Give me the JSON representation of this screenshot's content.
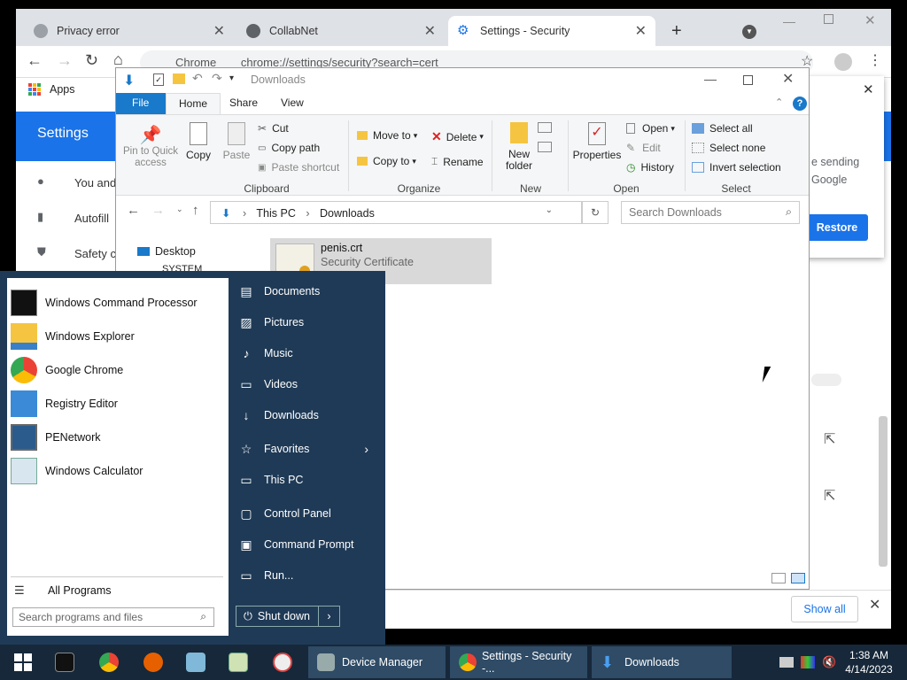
{
  "chrome": {
    "tabs": [
      {
        "title": "Privacy error",
        "icon": "warning-icon"
      },
      {
        "title": "CollabNet",
        "icon": "site-icon"
      },
      {
        "title": "Settings - Security",
        "icon": "gear-icon"
      }
    ],
    "new_tab": "+",
    "address_site": "Chrome",
    "address_url": "chrome://settings/security?search=cert",
    "apps_label": "Apps",
    "settings_title": "Settings",
    "nav": [
      {
        "label": "You and",
        "icon": "person-icon"
      },
      {
        "label": "Autofill",
        "icon": "clipboard-icon"
      },
      {
        "label": "Safety c",
        "icon": "shield-icon"
      }
    ],
    "dialog": {
      "text1": "e sending",
      "text2": "Google",
      "restore": "Restore"
    },
    "shelf": {
      "show_all": "Show all"
    }
  },
  "explorer": {
    "title": "Downloads",
    "tabs": {
      "file": "File",
      "home": "Home",
      "share": "Share",
      "view": "View"
    },
    "ribbon": {
      "pin": "Pin to Quick access",
      "copy": "Copy",
      "paste": "Paste",
      "cut": "Cut",
      "copy_path": "Copy path",
      "paste_shortcut": "Paste shortcut",
      "move_to": "Move to",
      "copy_to": "Copy to",
      "delete": "Delete",
      "rename": "Rename",
      "new_folder": "New folder",
      "properties": "Properties",
      "open": "Open",
      "edit": "Edit",
      "history": "History",
      "select_all": "Select all",
      "select_none": "Select none",
      "invert_selection": "Invert selection",
      "groups": {
        "clipboard": "Clipboard",
        "organize": "Organize",
        "new": "New",
        "open": "Open",
        "select": "Select"
      }
    },
    "breadcrumb": [
      "This PC",
      "Downloads"
    ],
    "search_placeholder": "Search Downloads",
    "nav": {
      "desktop": "Desktop",
      "system": "SYSTEM"
    },
    "file": {
      "name": "penis.crt",
      "type": "Security Certificate"
    }
  },
  "startmenu": {
    "programs": [
      {
        "label": "Windows Command Processor",
        "icon": "cmd-icon"
      },
      {
        "label": "Windows Explorer",
        "icon": "folder-icon"
      },
      {
        "label": "Google Chrome",
        "icon": "chrome-icon"
      },
      {
        "label": "Registry Editor",
        "icon": "registry-icon"
      },
      {
        "label": "PENetwork",
        "icon": "network-icon"
      },
      {
        "label": "Windows Calculator",
        "icon": "calculator-icon"
      }
    ],
    "all_programs": "All Programs",
    "search_placeholder": "Search programs and files",
    "links": [
      {
        "label": "Documents",
        "icon": "document-icon"
      },
      {
        "label": "Pictures",
        "icon": "picture-icon"
      },
      {
        "label": "Music",
        "icon": "music-icon"
      },
      {
        "label": "Videos",
        "icon": "video-icon"
      },
      {
        "label": "Downloads",
        "icon": "download-icon"
      },
      {
        "label": "Favorites",
        "icon": "star-icon"
      },
      {
        "label": "This PC",
        "icon": "computer-icon"
      },
      {
        "label": "Control Panel",
        "icon": "control-panel-icon"
      },
      {
        "label": "Command Prompt",
        "icon": "prompt-icon"
      },
      {
        "label": "Run...",
        "icon": "run-icon"
      }
    ],
    "shutdown": "Shut down"
  },
  "taskbar": {
    "tasks": [
      "Device Manager",
      "Settings - Security -...",
      "Downloads"
    ],
    "time": "1:38 AM",
    "date": "4/14/2023"
  },
  "colors": {
    "accent": "#1a73e8",
    "ribbon_file": "#1979ca",
    "start_bg": "#1f3a56",
    "taskbar": "#16283a"
  }
}
